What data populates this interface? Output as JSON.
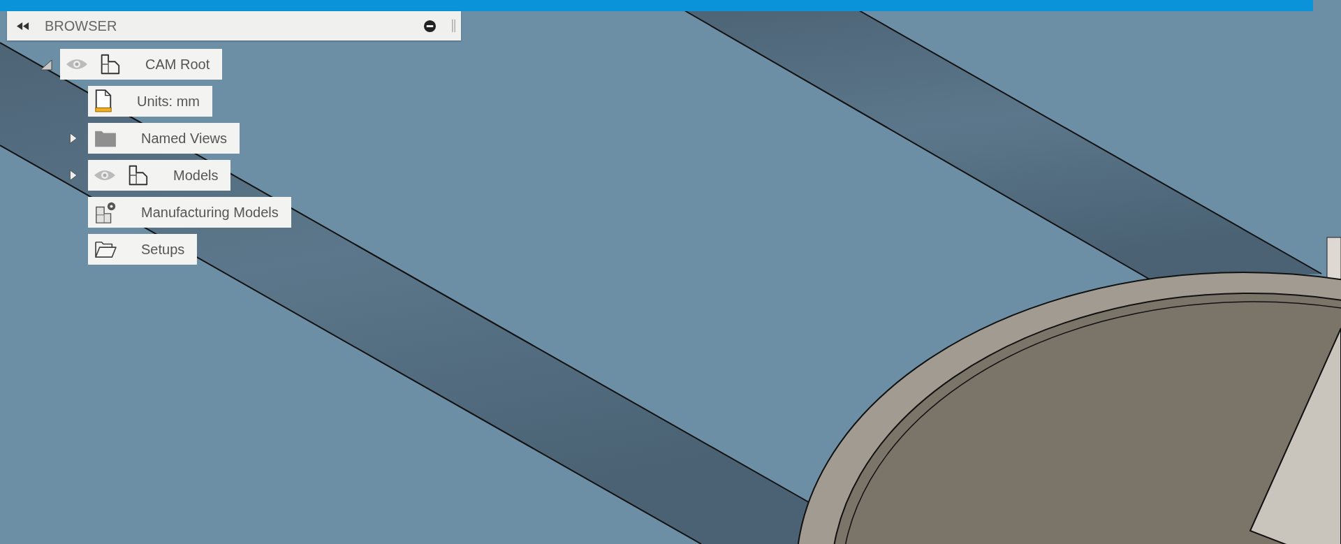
{
  "browser": {
    "title": "BROWSER",
    "tree": [
      {
        "label": "CAM Root",
        "kind": "component",
        "visible": true,
        "expanded": true,
        "children": [
          {
            "label": "Units: mm",
            "kind": "units"
          },
          {
            "label": "Named Views",
            "kind": "folder",
            "expanded": false
          },
          {
            "label": "Models",
            "kind": "component",
            "visible": true,
            "expanded": false
          },
          {
            "label": "Manufacturing Models",
            "kind": "manufacturing"
          },
          {
            "label": "Setups",
            "kind": "setups"
          }
        ]
      }
    ]
  }
}
